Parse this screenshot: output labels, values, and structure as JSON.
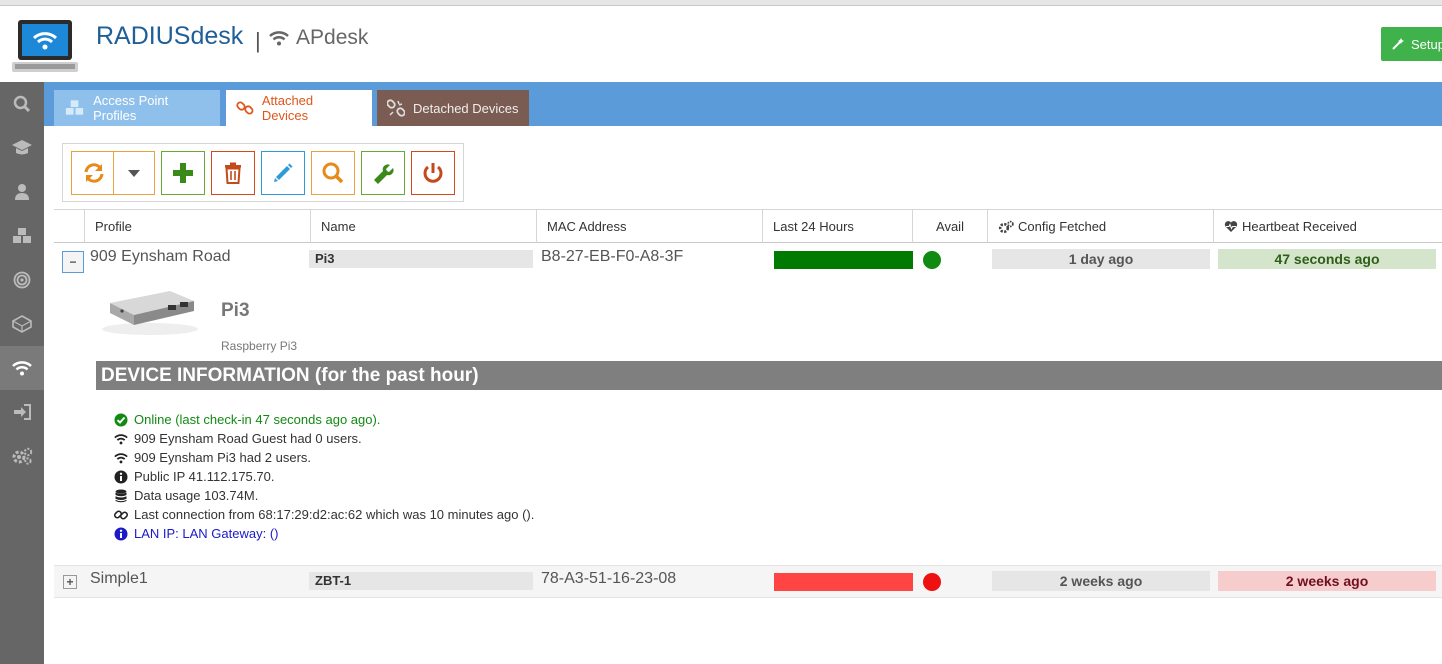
{
  "header": {
    "brand": "RADIUSdesk",
    "separator": "|",
    "sub_brand": "APdesk",
    "setup_label": "Setup"
  },
  "sidebar": {
    "items": [
      {
        "icon": "search-icon"
      },
      {
        "icon": "graduation-cap-icon"
      },
      {
        "icon": "user-icon"
      },
      {
        "icon": "cubes-icon"
      },
      {
        "icon": "bullseye-icon"
      },
      {
        "icon": "cube-outline-icon"
      },
      {
        "icon": "wifi-icon",
        "active": true
      },
      {
        "icon": "sign-in-icon"
      },
      {
        "icon": "cogs-icon"
      }
    ]
  },
  "tabs": [
    {
      "label": "Access Point Profiles"
    },
    {
      "label": "Attached Devices",
      "active": true
    },
    {
      "label": "Detached Devices"
    }
  ],
  "grid": {
    "columns": [
      "Profile",
      "Name",
      "MAC Address",
      "Last 24 Hours",
      "Avail",
      "Config Fetched",
      "Heartbeat Received"
    ],
    "rows": [
      {
        "expander": "−",
        "profile": "909 Eynsham Road",
        "name": "Pi3",
        "mac": "B8-27-EB-F0-A8-3F",
        "bar_color": "#007a00",
        "avail_color": "#118a11",
        "config_fetched": "1 day ago",
        "heartbeat": "47 seconds ago",
        "heartbeat_bg": "#d4e5cc",
        "heartbeat_color": "#2e5e1a"
      },
      {
        "expander": "+",
        "profile": "Simple1",
        "name": "ZBT-1",
        "mac": "78-A3-51-16-23-08",
        "bar_color": "#ff4444",
        "avail_color": "#ee1111",
        "config_fetched": "2 weeks ago",
        "heartbeat": "2 weeks ago",
        "heartbeat_bg": "#f6cccc",
        "heartbeat_color": "#6e1020"
      }
    ]
  },
  "device": {
    "name": "Pi3",
    "model": "Raspberry Pi3",
    "section_title": "DEVICE INFORMATION (for the past hour)",
    "info": [
      {
        "icon": "check-circle-icon",
        "text": "Online (last check-in 47 seconds ago ago).",
        "color": "#118a11"
      },
      {
        "icon": "wifi-icon",
        "text": "909 Eynsham Road Guest had 0 users.",
        "color": "#333333"
      },
      {
        "icon": "wifi-icon",
        "text": "909 Eynsham Pi3 had 2 users.",
        "color": "#333333"
      },
      {
        "icon": "info-circle-icon",
        "text": "Public IP 41.112.175.70.",
        "color": "#333333"
      },
      {
        "icon": "database-icon",
        "text": "Data usage 103.74M.",
        "color": "#333333"
      },
      {
        "icon": "link-icon",
        "text": "Last connection from 68:17:29:d2:ac:62 which was 10 minutes ago ().",
        "color": "#333333"
      },
      {
        "icon": "info-circle-icon",
        "text": "LAN IP: LAN Gateway: ()",
        "color": "#1a1ac8"
      }
    ]
  },
  "colors": {
    "tabbar": "#5b9bd9",
    "sidebar": "#666666",
    "accent_orange": "#e0561b",
    "brand_blue": "#1f5f98",
    "setup_green": "#3fb24b"
  }
}
